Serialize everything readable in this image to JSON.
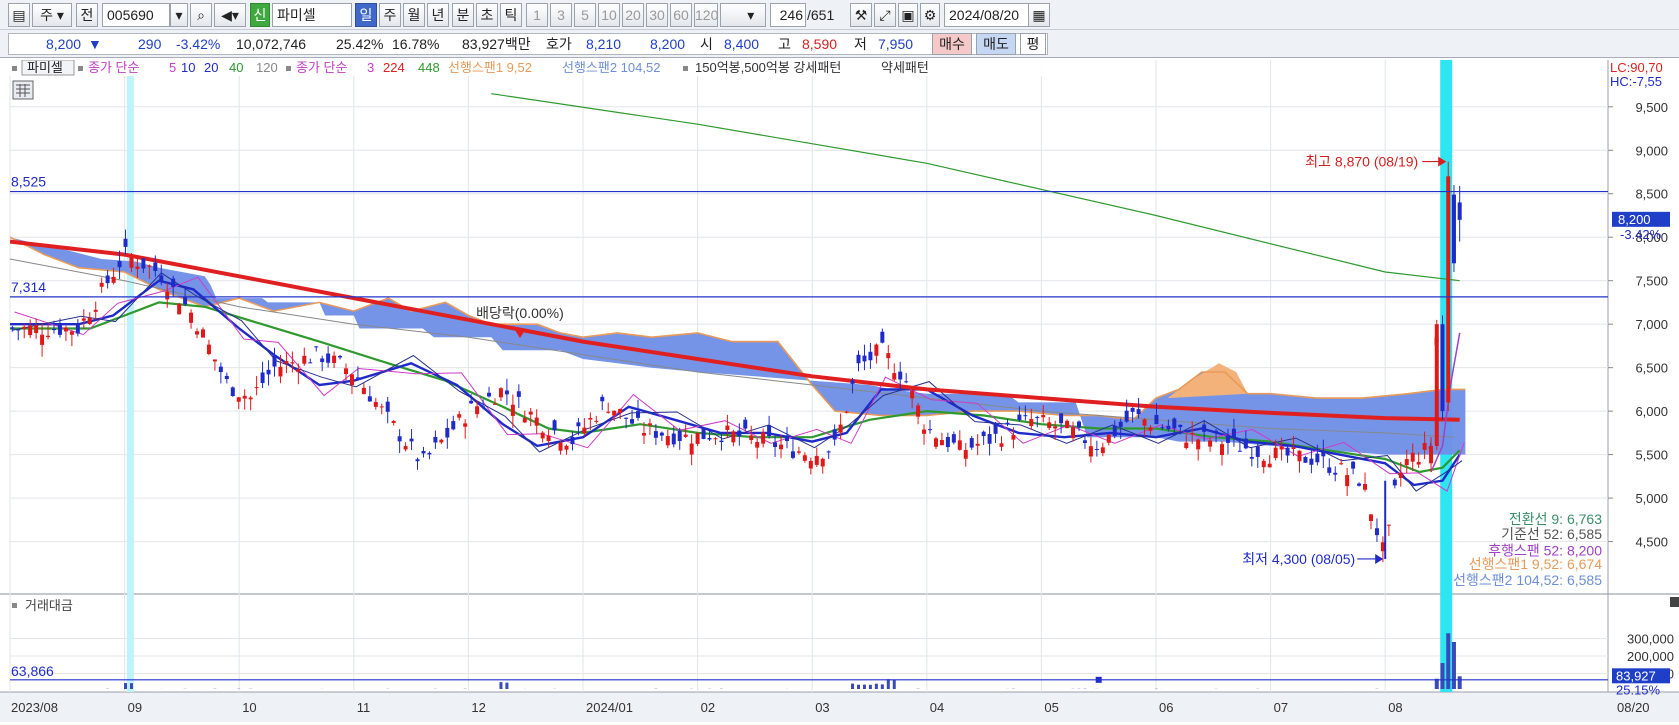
{
  "toolbar": {
    "market_type": "주",
    "prev_label": "전",
    "stock_code": "005690",
    "badge_new": "신",
    "stock_name": "파미셀",
    "periods": [
      "일",
      "주",
      "월",
      "년"
    ],
    "active_period": "일",
    "minute_labels": [
      "분",
      "초",
      "틱"
    ],
    "intervals": [
      "1",
      "3",
      "5",
      "10",
      "20",
      "30",
      "60",
      "120"
    ],
    "count_value": "246",
    "count_total": "/651",
    "date": "2024/08/20"
  },
  "quote": {
    "price": "8,200",
    "change_arrow": "▼",
    "change": "290",
    "change_pct": "-3.42%",
    "volume": "10,072,746",
    "turnover_pct": "25.42%",
    "ratio_pct": "16.78%",
    "amount": "83,927백만",
    "bid_label": "호가",
    "bid1": "8,210",
    "bid2": "8,200",
    "open_label": "시",
    "open": "8,400",
    "high_label": "고",
    "high": "8,590",
    "low_label": "저",
    "low": "7,950",
    "buy_label": "매수",
    "sell_label": "매도",
    "avg_label": "평"
  },
  "legend": {
    "name": "파미셀",
    "ma1_label": "종가 단순",
    "ma1_periods": [
      "5",
      "10",
      "20",
      "40",
      "120"
    ],
    "ma2_label": "종가 단순",
    "ma2_periods": [
      "3",
      "224",
      "448"
    ],
    "span1": "선행스팬1 9,52",
    "span2": "선행스팬2 104,52",
    "pattern": "150억봉,500억봉 강세패턴",
    "weak": "약세패턴"
  },
  "scale_labels": {
    "lc": "LC:90,70",
    "hc": "HC:-7,55"
  },
  "annotations": {
    "high_marker": "최고 8,870 (08/19)",
    "low_marker": "최저 4,300 (08/05)",
    "dividend": "배당락(0.00%)",
    "line_8525": "8,525",
    "line_7314": "7,314",
    "current_price": "8,200",
    "current_pct": "-3.42%",
    "volume_line": "63,866",
    "volume_current": "83,927",
    "volume_pct": "25.15%",
    "indicators": [
      "전환선 9: 6,763",
      "기준선 52: 6,585",
      "후행스팬 52: 8,200",
      "선행스팬1 9,52: 6,674",
      "선행스팬2 104,52: 6,585"
    ]
  },
  "volume_panel": {
    "title": "거래대금"
  },
  "chart_data": {
    "type": "line",
    "title": "",
    "price_axis": [
      "9,500",
      "9,000",
      "8,500",
      "8,000",
      "7,500",
      "7,000",
      "6,500",
      "6,000",
      "5,500",
      "5,000",
      "4,500"
    ],
    "price_ticks": [
      9500,
      9000,
      8500,
      8000,
      7500,
      7000,
      6500,
      6000,
      5500,
      5000,
      4500
    ],
    "ylim": [
      4150,
      9900
    ],
    "volume_axis": [
      "300,000",
      "200,000",
      "100,000"
    ],
    "volume_ticks": [
      300000,
      200000,
      100000
    ],
    "x_labels": [
      "2023/08",
      "09",
      "10",
      "11",
      "12",
      "2024/01",
      "02",
      "03",
      "04",
      "05",
      "06",
      "07",
      "08",
      "08/20"
    ],
    "x_label_months": [
      0,
      1,
      2,
      3,
      4,
      5,
      6,
      7,
      8,
      9,
      10,
      11,
      12,
      12.65
    ],
    "series": [
      {
        "name": "종가",
        "color": "#2a2aa0",
        "x": [
          0.6,
          1.0,
          1.3,
          1.6,
          1.9,
          2.1,
          2.3,
          2.7,
          3.0,
          3.3,
          3.6,
          4.0,
          4.3,
          4.6,
          4.9,
          5.0,
          5.2,
          5.5,
          5.9,
          6.2,
          6.6,
          7.0,
          7.2,
          7.4,
          7.6,
          7.8,
          8.0,
          8.3,
          8.6,
          8.9,
          9.2,
          9.5,
          9.8,
          10.0,
          10.3,
          10.6,
          11.0,
          11.4,
          11.8,
          12.0,
          12.1,
          12.2,
          12.3,
          12.4,
          12.45,
          12.5,
          12.55,
          12.6,
          12.65
        ],
        "y": [
          6950,
          7800,
          7600,
          7100,
          6300,
          6150,
          6500,
          6650,
          6450,
          5900,
          5400,
          6000,
          6250,
          5900,
          5650,
          5800,
          6100,
          5800,
          5700,
          5750,
          5650,
          5500,
          5600,
          6500,
          6700,
          6400,
          5800,
          5550,
          5700,
          5900,
          5800,
          5600,
          5950,
          5850,
          5700,
          5650,
          5500,
          5450,
          5200,
          4300,
          5200,
          5450,
          5500,
          5600,
          6900,
          6000,
          8870,
          7600,
          8200
        ]
      },
      {
        "name": "종가 단순 224",
        "color": "#e02020",
        "x": [
          0,
          1,
          2,
          3,
          4,
          5,
          6,
          7,
          8,
          9,
          10,
          11,
          12,
          12.65
        ],
        "y": [
          7950,
          7800,
          7550,
          7300,
          7050,
          6800,
          6600,
          6400,
          6250,
          6150,
          6050,
          5980,
          5920,
          5900
        ]
      },
      {
        "name": "종가 단순 448",
        "color": "#2e9a2e",
        "x": [
          4.2,
          6,
          8,
          10,
          12,
          12.65
        ],
        "y": [
          9650,
          9300,
          8850,
          8250,
          7600,
          7500
        ]
      }
    ]
  }
}
